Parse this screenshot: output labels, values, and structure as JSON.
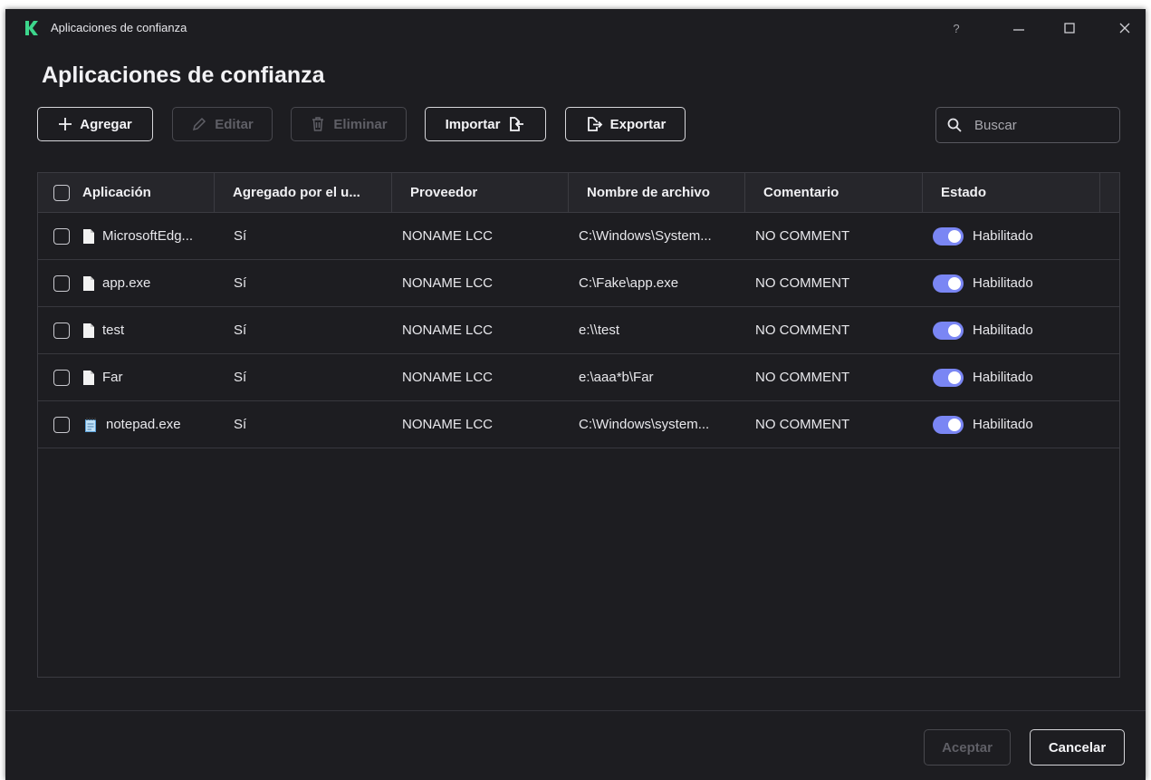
{
  "window": {
    "title": "Aplicaciones de confianza",
    "help": "?",
    "brand_color": "#3dd68c"
  },
  "page": {
    "title": "Aplicaciones de confianza"
  },
  "toolbar": {
    "add_label": "Agregar",
    "edit_label": "Editar",
    "delete_label": "Eliminar",
    "import_label": "Importar",
    "export_label": "Exportar"
  },
  "search": {
    "placeholder": "Buscar"
  },
  "table": {
    "columns": [
      "Aplicación",
      "Agregado por el u...",
      "Proveedor",
      "Nombre de archivo",
      "Comentario",
      "Estado"
    ],
    "rows": [
      {
        "app": "MicrosoftEdg...",
        "icon": "file-icon",
        "added": "Sí",
        "vendor": "NONAME LCC",
        "file": "C:\\Windows\\System...",
        "comment": "NO COMMENT",
        "status": "Habilitado"
      },
      {
        "app": "app.exe",
        "icon": "file-icon",
        "added": "Sí",
        "vendor": "NONAME LCC",
        "file": "C:\\Fake\\app.exe",
        "comment": "NO COMMENT",
        "status": "Habilitado"
      },
      {
        "app": "test",
        "icon": "file-icon",
        "added": "Sí",
        "vendor": "NONAME LCC",
        "file": "e:\\\\test",
        "comment": "NO COMMENT",
        "status": "Habilitado"
      },
      {
        "app": "Far",
        "icon": "file-icon",
        "added": "Sí",
        "vendor": "NONAME LCC",
        "file": "e:\\aaa*b\\Far",
        "comment": "NO COMMENT",
        "status": "Habilitado"
      },
      {
        "app": "notepad.exe",
        "icon": "notepad-icon",
        "added": "Sí",
        "vendor": "NONAME LCC",
        "file": "C:\\Windows\\system...",
        "comment": "NO COMMENT",
        "status": "Habilitado"
      }
    ],
    "toggle_color": "#7a86f4"
  },
  "footer": {
    "ok_label": "Aceptar",
    "cancel_label": "Cancelar"
  }
}
